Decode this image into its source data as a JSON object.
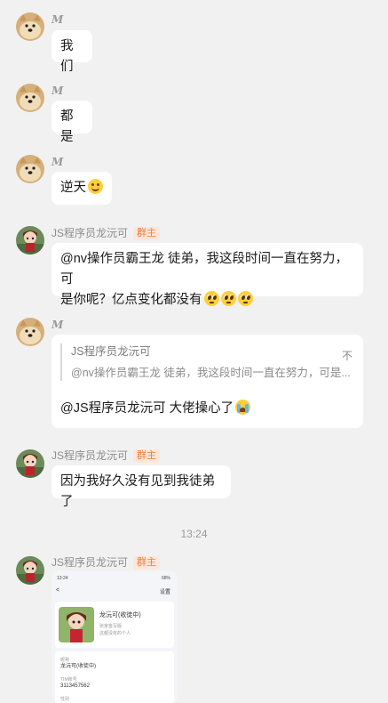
{
  "messages": [
    {
      "sender": "M",
      "text": "我们"
    },
    {
      "sender": "M",
      "text": "都是"
    },
    {
      "sender": "M",
      "text": "逆天",
      "emoji": "smile-emoji"
    },
    {
      "sender": "JS程序员龙沅可",
      "badge": "群主",
      "line1": "@nv操作员霸王龙 徒弟，我这段时间一直在努力，可",
      "line2": "是你呢？亿点变化都没有",
      "emoji": "pleading-emoji"
    },
    {
      "sender": "M",
      "quote": {
        "name": "JS程序员龙沅可",
        "flag": "不",
        "text": "@nv操作员霸王龙 徒弟，我这段时间一直在努力，可是..."
      },
      "text": "@JS程序员龙沅可 大佬操心了",
      "emoji": "crying-emoji"
    },
    {
      "sender": "JS程序员龙沅可",
      "badge": "群主",
      "text": "因为我好久没有见到我徒弟了"
    },
    {
      "sender": "JS程序员龙沅可",
      "badge": "群主",
      "image": {
        "status_time": "13:24",
        "status_battery": "68%",
        "back": "<",
        "settings": "设置",
        "profile_name": "龙沅可(收徒中)",
        "profile_sub": "张家金写版",
        "profile_note": "这都没有的个人",
        "field1_label": "昵称",
        "field1_value": "龙沅可(收徒中)",
        "field2_label": "TIM账号",
        "field2_value": "3113457562",
        "field3_label": "性别"
      }
    }
  ],
  "timestamp": "13:24",
  "colors": {
    "background": "#f1f1f1",
    "bubble": "#ffffff",
    "badge_text": "#f07b3f",
    "badge_bg": "#fde6da"
  }
}
